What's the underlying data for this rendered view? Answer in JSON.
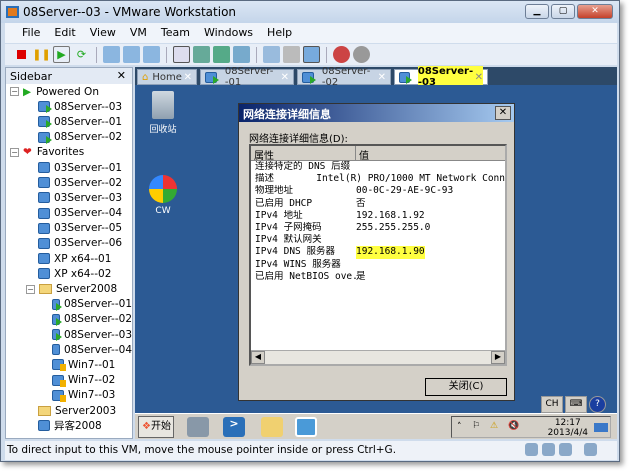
{
  "window": {
    "title": "08Server--03 - VMware Workstation"
  },
  "menu": [
    "File",
    "Edit",
    "View",
    "VM",
    "Team",
    "Windows",
    "Help"
  ],
  "sidebar": {
    "title": "Sidebar",
    "close": "✕",
    "powered_on": {
      "label": "Powered On",
      "items": [
        "08Server--03",
        "08Server--01",
        "08Server--02"
      ]
    },
    "favorites": {
      "label": "Favorites",
      "items": [
        "03Server--01",
        "03Server--02",
        "03Server--03",
        "03Server--04",
        "03Server--05",
        "03Server--06",
        "XP x64--01",
        "XP x64--02"
      ]
    },
    "server2008": {
      "label": "Server2008",
      "items": [
        {
          "n": "08Server--01",
          "s": "on"
        },
        {
          "n": "08Server--02",
          "s": "on"
        },
        {
          "n": "08Server--03",
          "s": "on"
        },
        {
          "n": "08Server--04",
          "s": "off"
        },
        {
          "n": "Win7--01",
          "s": "paused"
        },
        {
          "n": "Win7--02",
          "s": "paused"
        },
        {
          "n": "Win7--03",
          "s": "paused"
        }
      ]
    },
    "server2003": "Server2003",
    "other": "异客2008"
  },
  "tabs": [
    {
      "label": "Home"
    },
    {
      "label": "08Server--01"
    },
    {
      "label": "08Server--02"
    },
    {
      "label": "08Server--03",
      "active": true
    }
  ],
  "desktop": {
    "recycle": "回收站",
    "cw": "CW"
  },
  "dialog": {
    "title": "网络连接详细信息",
    "label": "网络连接详细信息(D):",
    "col1": "属性",
    "col2": "值",
    "rows": [
      [
        "连接特定的 DNS 后缀",
        ""
      ],
      [
        "描述",
        "Intel(R) PRO/1000 MT Network Conn"
      ],
      [
        "物理地址",
        "00-0C-29-AE-9C-93"
      ],
      [
        "已启用 DHCP",
        "否"
      ],
      [
        "IPv4 地址",
        "192.168.1.92"
      ],
      [
        "IPv4 子网掩码",
        "255.255.255.0"
      ],
      [
        "IPv4 默认网关",
        ""
      ],
      [
        "IPv4 DNS 服务器",
        "192.168.1.90"
      ],
      [
        "IPv4 WINS 服务器",
        ""
      ],
      [
        "已启用 NetBIOS ove...",
        "是"
      ]
    ],
    "close_button": "关闭(C)"
  },
  "langbar": {
    "lang": "CH",
    "help": "?"
  },
  "guest_taskbar": {
    "start": "开始",
    "time": "12:17",
    "date": "2013/4/4"
  },
  "status": "To direct input to this VM, move the mouse pointer inside or press Ctrl+G.",
  "colors": {
    "highlight": "#ffff40",
    "desktop": "#2c5a94"
  }
}
